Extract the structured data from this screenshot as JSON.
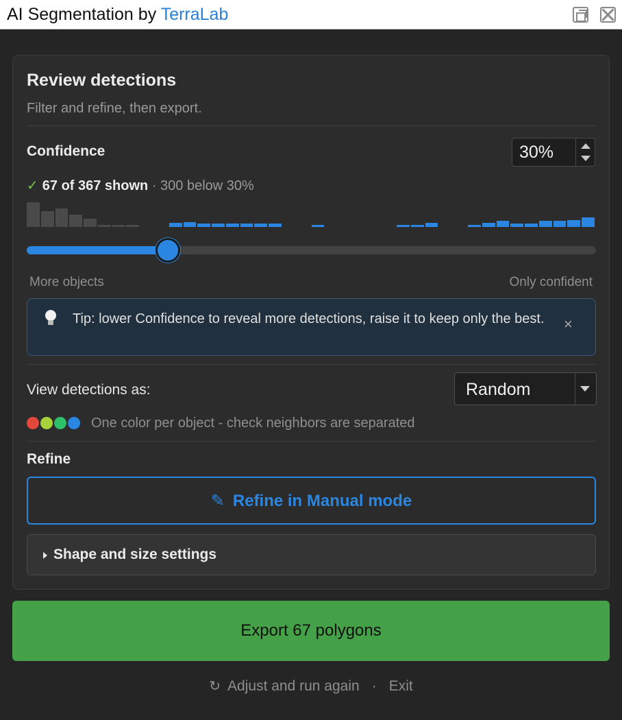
{
  "window": {
    "title_prefix": "AI Segmentation by ",
    "title_brand": "TerraLab",
    "brand_color": "#2a80d8",
    "buttons": [
      "float-icon",
      "close-icon"
    ]
  },
  "review": {
    "title": "Review detections",
    "subtitle": "Filter and refine, then export."
  },
  "confidence": {
    "label": "Confidence",
    "value_text": "30%",
    "value": 30,
    "shown_check": "✓",
    "shown_text": "67 of 367 shown",
    "below_text": " · 300 below 30%",
    "range_low_label": "More objects",
    "range_high_label": "Only confident",
    "slider_fraction": 0.248,
    "histogram": {
      "bins": [
        32,
        20,
        24,
        16,
        11,
        3,
        3,
        3,
        0,
        0,
        5,
        6,
        4,
        4,
        4,
        4,
        4,
        4,
        0,
        0,
        3,
        0,
        0,
        0,
        0,
        0,
        3,
        3,
        5,
        0,
        0,
        3,
        5,
        8,
        4,
        4,
        8,
        8,
        9,
        12
      ],
      "threshold_bin": 9,
      "below_color": "#4a4a4a",
      "above_color": "#2a86e0"
    }
  },
  "tip": {
    "icon": "lightbulb-icon",
    "text": "Tip: lower Confidence to reveal more detections, raise it to keep only the best.",
    "close": "×"
  },
  "view": {
    "label": "View detections as:",
    "selected": "Random",
    "colors": [
      "#e2493b",
      "#a8d23a",
      "#2fbe6a",
      "#2a86e0"
    ],
    "color_description": "One color per object - check neighbors are separated"
  },
  "refine": {
    "label": "Refine",
    "pencil": "✎",
    "manual_button": "Refine in Manual mode",
    "shape_settings": "Shape and size settings"
  },
  "export": {
    "button": "Export 67 polygons",
    "color": "#45a147"
  },
  "footer": {
    "redo_icon": "↻",
    "adjust": "Adjust and run again",
    "separator": "·",
    "exit": "Exit"
  }
}
